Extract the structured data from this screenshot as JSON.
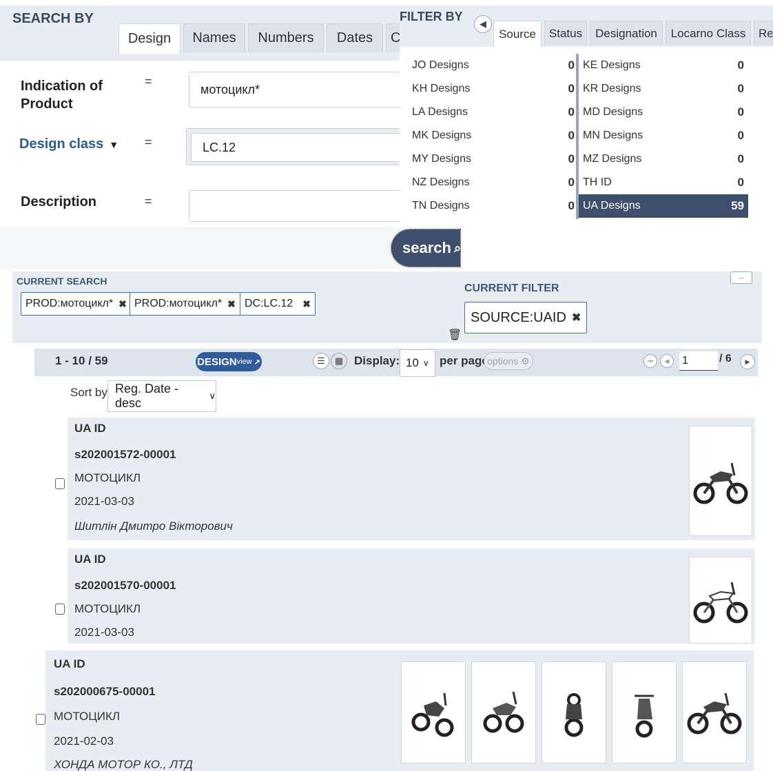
{
  "search": {
    "title": "SEARCH BY",
    "tabs": [
      "Design",
      "Names",
      "Numbers",
      "Dates",
      "C"
    ],
    "fields": [
      {
        "label_line1": "Indication of",
        "label_line2": "Product",
        "operator": "=",
        "value": "мотоцикл*"
      },
      {
        "label": "Design class",
        "operator": "=",
        "value": "LC.12"
      },
      {
        "label": "Description",
        "operator": "=",
        "value": ""
      }
    ],
    "button_label": "search"
  },
  "filter": {
    "title": "FILTER BY",
    "tabs": [
      "Source",
      "Status",
      "Designation",
      "Locarno Class",
      "Re"
    ],
    "left_rows": [
      {
        "name": "JO Designs",
        "count": "0"
      },
      {
        "name": "KH Designs",
        "count": "0"
      },
      {
        "name": "LA Designs",
        "count": "0"
      },
      {
        "name": "MK Designs",
        "count": "0"
      },
      {
        "name": "MY Designs",
        "count": "0"
      },
      {
        "name": "NZ Designs",
        "count": "0"
      },
      {
        "name": "TN Designs",
        "count": "0"
      }
    ],
    "right_rows": [
      {
        "name": "KE Designs",
        "count": "0"
      },
      {
        "name": "KR Designs",
        "count": "0"
      },
      {
        "name": "MD Designs",
        "count": "0"
      },
      {
        "name": "MN Designs",
        "count": "0"
      },
      {
        "name": "MZ Designs",
        "count": "0"
      },
      {
        "name": "TH ID",
        "count": "0"
      },
      {
        "name": "UA Designs",
        "count": "59",
        "selected": true
      }
    ]
  },
  "current_search": {
    "title": "CURRENT SEARCH",
    "chips": [
      "PROD:мотоцикл*",
      "PROD:мотоцикл*",
      "DC:LC.12"
    ]
  },
  "current_filter": {
    "title": "CURRENT FILTER",
    "chips": [
      "SOURCE:UAID"
    ]
  },
  "results_toolbar": {
    "count": "1 - 10 / 59",
    "design_view": "DESIGN",
    "design_view_small": "view",
    "display_label": "Display:",
    "display_value": "10",
    "per_page_label": "per page",
    "options_label": "options",
    "page_value": "1",
    "page_total": "/ 6"
  },
  "sort": {
    "label": "Sort by",
    "value": "Reg. Date - desc"
  },
  "results": [
    {
      "type": "UA ID",
      "number": "s202001572-00001",
      "product": "МОТОЦИКЛ",
      "date": "2021-03-03",
      "owner": "Шитлін Дмитро Вікторович"
    },
    {
      "type": "UA ID",
      "number": "s202001570-00001",
      "product": "МОТОЦИКЛ",
      "date": "2021-03-03"
    },
    {
      "type": "UA ID",
      "number": "s202000675-00001",
      "product": "МОТОЦИКЛ",
      "date": "2021-02-03",
      "owner": "ХОНДА МОТОР КО., ЛТД"
    }
  ],
  "colors": {
    "accent": "#3d4f6b",
    "selected_row": "#3d4f6b",
    "panel": "#e8edf2"
  },
  "icons": [
    "search-icon",
    "close-icon",
    "trash-icon",
    "list-view-icon",
    "grid-view-icon",
    "gear-icon",
    "first-page-icon",
    "prev-page-icon",
    "next-page-icon",
    "external-link-icon",
    "dropdown-caret-icon"
  ]
}
